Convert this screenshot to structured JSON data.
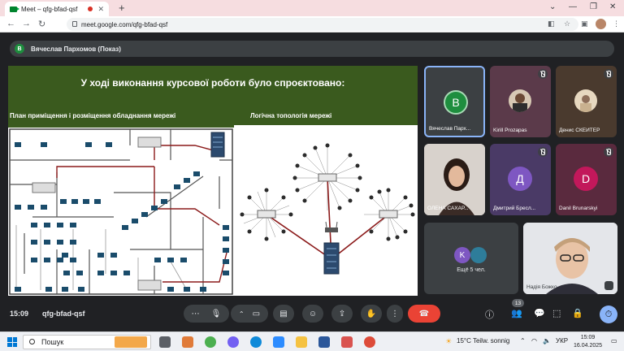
{
  "browser": {
    "tab_title": "Meet – qfg-bfad-qsf",
    "new_tab": "+",
    "url": "meet.google.com/qfg-bfad-qsf"
  },
  "meet": {
    "presenter_initial": "В",
    "presenter_label": "Вячеслав Пархомов (Показ)",
    "time": "15:09",
    "meeting_code": "qfg-bfad-qsf",
    "participants_count": "13"
  },
  "slide": {
    "heading": "У ході виконання курсової роботи було спроєктовано:",
    "plan_title": "План приміщення і розміщення обладнання мережі",
    "logic_title": "Логічна топологія мережі"
  },
  "tiles": [
    {
      "name": "Вячеслав Парх...",
      "initial": "В",
      "color": "#1e8e3e",
      "muted": false
    },
    {
      "name": "Kirill Prozapas",
      "muted": true
    },
    {
      "name": "Денис СКЕЙТЕР",
      "muted": true
    },
    {
      "name": "ОЛЕНА САХАР...",
      "muted": true
    },
    {
      "name": "Дмитрий Бресл...",
      "initial": "Д",
      "color": "#7e57c2",
      "muted": true
    },
    {
      "name": "Danil Brunarskyi",
      "initial": "D",
      "color": "#c2185b",
      "muted": true
    },
    {
      "name": "Ещё 5 чел.",
      "initial": "K",
      "color": "#7e57c2"
    },
    {
      "name": "Надія Божко"
    }
  ],
  "taskbar": {
    "search_placeholder": "Пошук",
    "weather": "15°C  Teilw. sonnig",
    "lang": "УКР",
    "clock_time": "15:09",
    "clock_date": "16.04.2025"
  }
}
